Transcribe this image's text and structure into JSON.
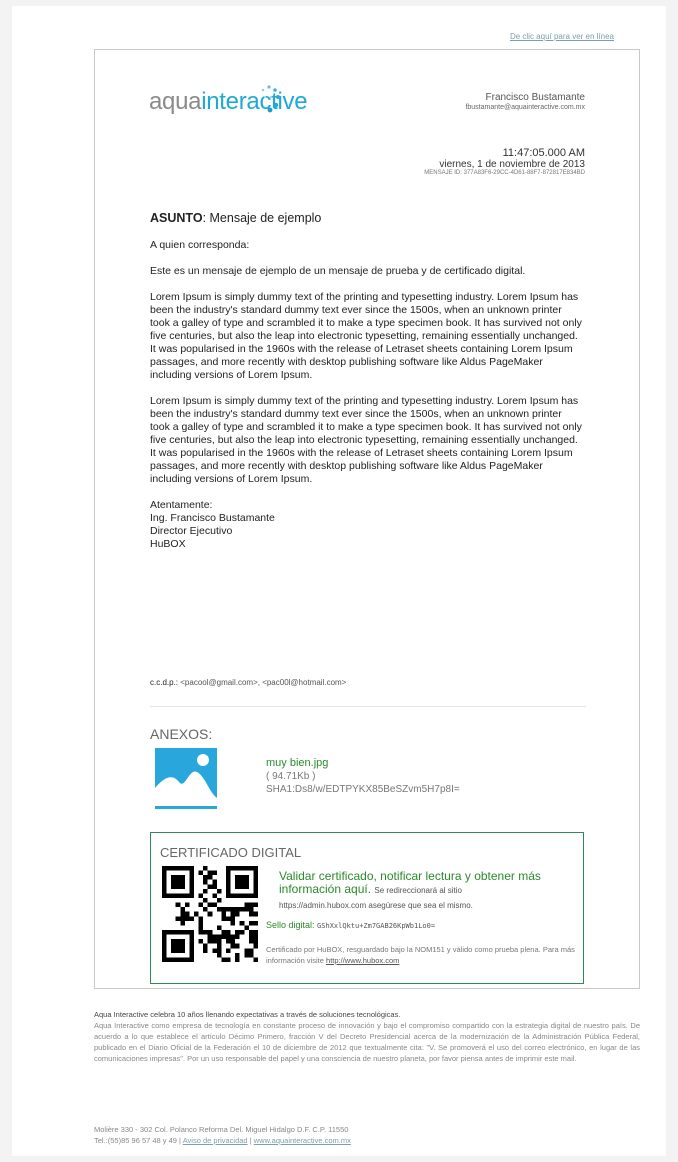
{
  "header": {
    "online_link": "De clic aquí para ver en línea"
  },
  "logo": {
    "part1": "aqua",
    "part2": "interactive"
  },
  "sender": {
    "name": "Francisco Bustamante",
    "email": "fbustamante@aquainteractive.com.mx"
  },
  "meta": {
    "time": "11:47:05.000 AM",
    "date": "viernes, 1 de noviembre de 2013",
    "message_id": "MENSAJE ID: 377A83F6-29CC-4D61-88F7-872817E834BD"
  },
  "message": {
    "subject_label": "ASUNTO",
    "subject": ": Mensaje de ejemplo",
    "greeting": "A quien corresponda:",
    "intro": "Este es un mensaje de ejemplo de un mensaje de prueba y de certificado digital.",
    "paragraph1": "Lorem Ipsum is simply dummy text of the printing and typesetting industry. Lorem Ipsum has been the industry's standard dummy text ever since the 1500s, when an unknown printer took a galley of type and scrambled it to make a type specimen book. It has survived not only five centuries, but also the leap into electronic typesetting, remaining essentially unchanged. It was popularised in the 1960s with the release of Letraset sheets containing Lorem Ipsum passages, and more recently with desktop publishing software like Aldus PageMaker including versions of Lorem Ipsum.",
    "paragraph2": "Lorem Ipsum is simply dummy text of the printing and typesetting industry. Lorem Ipsum has been the industry's standard dummy text ever since the 1500s, when an unknown printer took a galley of type and scrambled it to make a type specimen book. It has survived not only five centuries, but also the leap into electronic typesetting, remaining essentially unchanged. It was popularised in the 1960s with the release of Letraset sheets containing Lorem Ipsum passages, and more recently with desktop publishing software like Aldus PageMaker including versions of Lorem Ipsum.",
    "closing": "Atentamente:",
    "signer": "Ing. Francisco Bustamante",
    "role": "Director Ejecutivo",
    "company": "HuBOX"
  },
  "ccdp": {
    "label": "c.c.d.p.:",
    "emails": "<pacool@gmail.com>, <pac00l@hotmail.com>"
  },
  "attachments": {
    "title": "ANEXOS:",
    "items": [
      {
        "name": "muy bien.jpg",
        "size": "( 94.71Kb )",
        "sha": "SHA1:Ds8/w/EDTPYKX85BeSZvm5H7p8I="
      }
    ]
  },
  "certificate": {
    "title": "CERTIFICADO DIGITAL",
    "cta": "Validar certificado, notificar lectura y obtener más información aquí.",
    "cta_small": "Se redireccionará al sitio",
    "url_line": "https://admin.hubox.com asegúrese que sea el mismo.",
    "seal_label": "Sello digital:",
    "seal_code": "GShXxlQktu+Zm7GAB26KpWb1Lo0=",
    "note": "Certificado por HuBOX, resguardado bajo la NOM151 y válido como prueba plena. Para más información visite",
    "note_link": "http://www.hubox.com"
  },
  "footer": {
    "lead": "Aqua Interactive celebra 10 años llenando expectativas a través de soluciones tecnológicas.",
    "body": "Aqua Interactive como empresa de tecnología en constante proceso de innovación y bajo el compromiso compartido con la estrategia digital de nuestro país. De acuerdo a lo que establece el artículo Décimo Primero, fracción V del Decreto Presidencial acerca de la modernización de la Administración Pública Federal, publicado en el Diario Oficial de la Federación el 10 de diciembre de 2012 que textualmente cita: \"V. Se promoverá el uso del correo electrónico, en lugar de las comunicaciones impresas\". Por un uso responsable del papel y una consciencia de nuestro planeta, por favor piensa antes de imprimir este mail.",
    "address": "Molière 330 - 302 Col. Polanco Reforma Del. Miguel Hidalgo D.F. C.P. 11550",
    "phone": "Tel.:(55)85 96 57 48 y 49 |",
    "privacy_link": "Aviso de privacidad",
    "separator": "|",
    "site_link": "www.aquainteractive.com.mx"
  },
  "colors": {
    "brand_blue": "#1fa9d6",
    "green": "#2c8a2c",
    "border_green": "#2e8a5c",
    "link_blue": "#7a9fb0"
  }
}
